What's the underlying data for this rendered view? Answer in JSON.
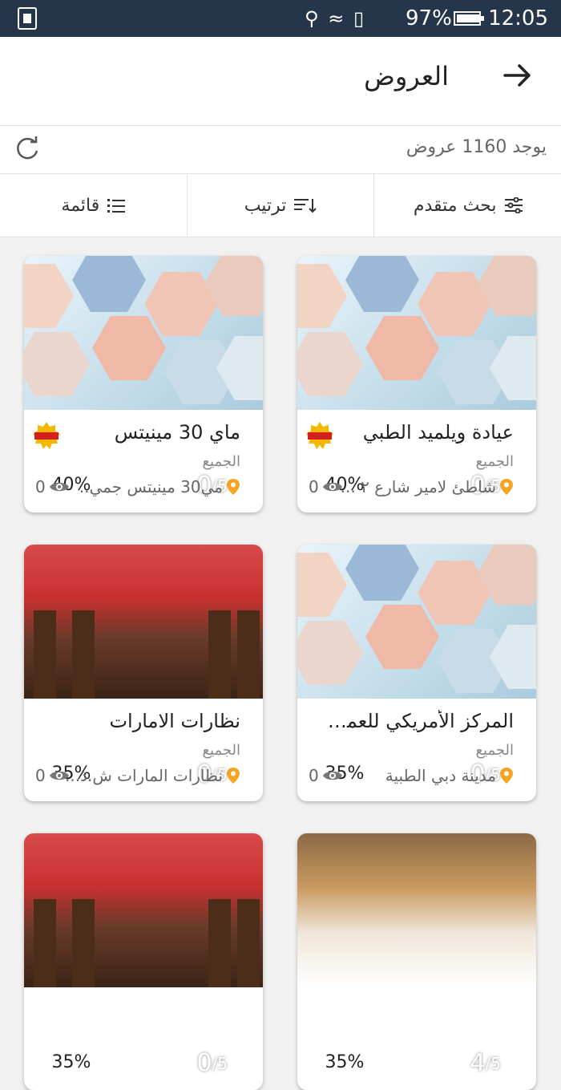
{
  "status": {
    "battery": "97%",
    "time": "12:05",
    "battery_fill": 0.97
  },
  "header": {
    "title": "العروض"
  },
  "count_text": "يوجد 1160 عروض",
  "filters": {
    "advanced": "بحث متقدم",
    "sort": "ترتيب",
    "list": "قائمة"
  },
  "cards": [
    {
      "discount": "40%",
      "rating": "0",
      "rating_of": "/5",
      "name": "عيادة ويلميد الطبي",
      "category": "الجميع",
      "location": "شاطئ لامير شارع ٢ ...",
      "views": "0",
      "image": "medical-collage"
    },
    {
      "discount": "40%",
      "rating": "0",
      "rating_of": "/5",
      "name": "ماي 30 مينيتس",
      "category": "الجميع",
      "location": "مي30 مينيتس جمي..",
      "views": "0",
      "image": "medical-collage"
    },
    {
      "discount": "35%",
      "rating": "0",
      "rating_of": "/5",
      "name": "المركز الأمريكي للعمود ...",
      "category": "الجميع",
      "location": "مدينة دبي الطبية",
      "views": "0",
      "image": "medical-collage"
    },
    {
      "discount": "35%",
      "rating": "0",
      "rating_of": "/5",
      "name": "نظارات الامارات",
      "category": "الجميع",
      "location": "نظارات المارات ش.ذ...",
      "views": "0",
      "image": "store-interior"
    },
    {
      "discount": "35%",
      "rating": "4",
      "rating_of": "/5",
      "name": "",
      "category": "",
      "location": "",
      "views": "",
      "image": "food-plate"
    },
    {
      "discount": "35%",
      "rating": "0",
      "rating_of": "/5",
      "name": "",
      "category": "",
      "location": "",
      "views": "",
      "image": "store-interior"
    }
  ]
}
